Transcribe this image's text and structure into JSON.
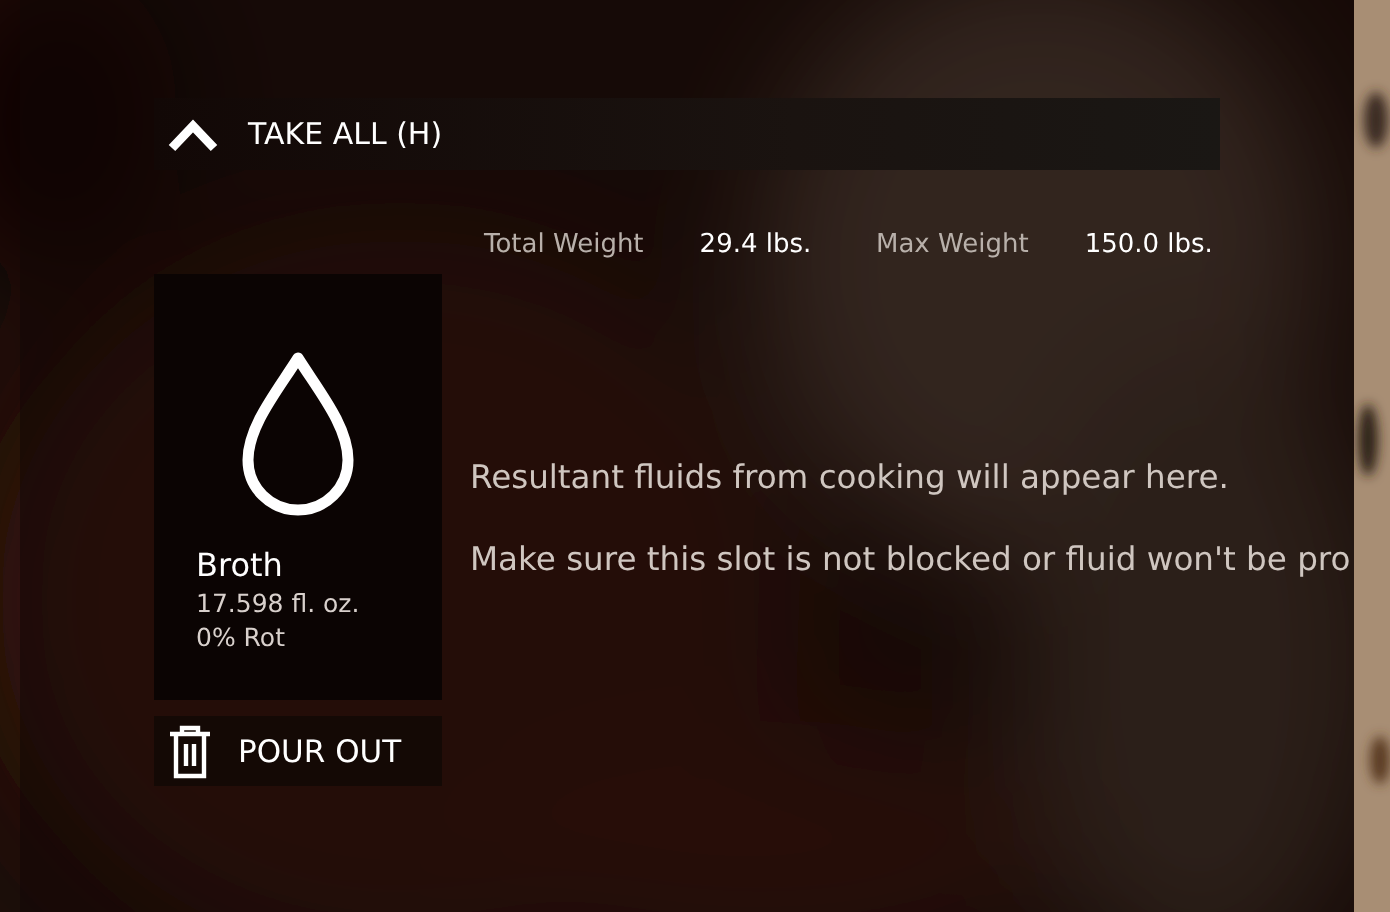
{
  "take_all": {
    "label": "TAKE ALL (H)"
  },
  "weights": [
    {
      "label": "Total Weight",
      "value": "29.4 lbs."
    },
    {
      "label": "Max Weight",
      "value": "150.0 lbs."
    }
  ],
  "slot": {
    "name": "Broth",
    "amount": "17.598 fl. oz.",
    "rot": "0% Rot"
  },
  "pour_out": {
    "label": "POUR OUT"
  },
  "messages": [
    "Resultant fluids from cooking will appear here.",
    "Make sure this slot is not blocked or fluid won't be pro"
  ]
}
